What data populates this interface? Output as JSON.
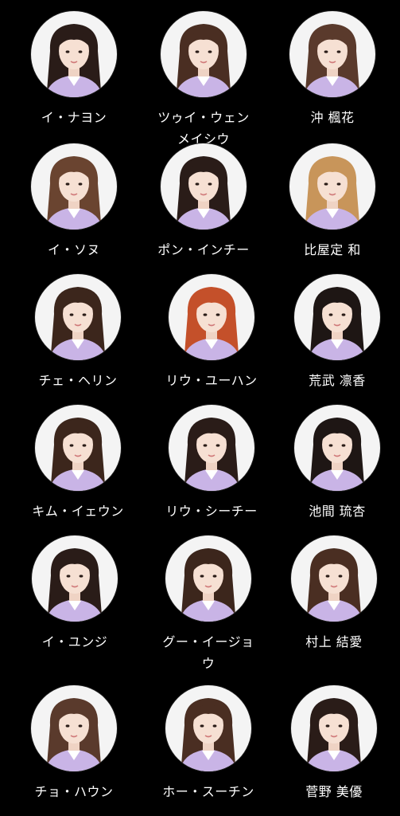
{
  "colors": {
    "background": "#000000",
    "text": "#ffffff",
    "portrait_bg": "#f4f4f4",
    "uniform": "#c9b4e6"
  },
  "members": [
    {
      "name": "イ・ナヨン",
      "hair": "#2a1c18"
    },
    {
      "name": "ツゥイ・ウェンメイシウ",
      "hair": "#4a2e22"
    },
    {
      "name": "沖 楓花",
      "hair": "#5a3a2c"
    },
    {
      "name": "イ・ソヌ",
      "hair": "#6a4430"
    },
    {
      "name": "ポン・インチー",
      "hair": "#2a1c18"
    },
    {
      "name": "比屋定 和",
      "hair": "#c8955a"
    },
    {
      "name": "チェ・ヘリン",
      "hair": "#3c261c"
    },
    {
      "name": "リウ・ユーハン",
      "hair": "#c4502a"
    },
    {
      "name": "荒武 凛香",
      "hair": "#1e1614"
    },
    {
      "name": "キム・イェウン",
      "hair": "#3c261c"
    },
    {
      "name": "リウ・シーチー",
      "hair": "#2a1c18"
    },
    {
      "name": "池間 琉杏",
      "hair": "#1e1614"
    },
    {
      "name": "イ・ユンジ",
      "hair": "#2a1c18"
    },
    {
      "name": "グー・イージョウ",
      "hair": "#3c261c"
    },
    {
      "name": "村上 結愛",
      "hair": "#4a2e22"
    },
    {
      "name": "チョ・ハウン",
      "hair": "#5a3a2c"
    },
    {
      "name": "ホー・スーチン",
      "hair": "#4a2e22"
    },
    {
      "name": "菅野 美優",
      "hair": "#2a1c18"
    }
  ]
}
